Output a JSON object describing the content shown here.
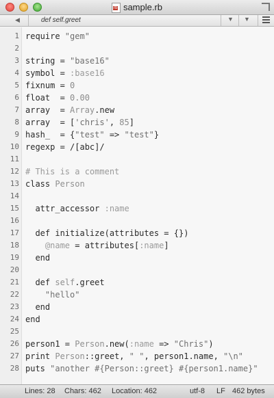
{
  "window": {
    "title": "sample.rb",
    "file_icon_text": "rb",
    "icons": [
      "close-button",
      "minimize-button",
      "zoom-button",
      "ruby-file-icon",
      "fullscreen-icon"
    ]
  },
  "symbol_bar": {
    "current_symbol": "def self.greet",
    "left_arrow": "◀",
    "down_arrow_1": "▼",
    "down_arrow_2": "▼"
  },
  "editor": {
    "lines": [
      {
        "n": "1",
        "segs": [
          [
            "p",
            "require "
          ],
          [
            "s",
            "\"gem\""
          ]
        ]
      },
      {
        "n": "2",
        "segs": []
      },
      {
        "n": "3",
        "segs": [
          [
            "p",
            "string = "
          ],
          [
            "s",
            "\"base16\""
          ]
        ]
      },
      {
        "n": "4",
        "segs": [
          [
            "p",
            "symbol = "
          ],
          [
            "y",
            ":base16"
          ]
        ]
      },
      {
        "n": "5",
        "segs": [
          [
            "p",
            "fixnum = "
          ],
          [
            "n",
            "0"
          ]
        ]
      },
      {
        "n": "6",
        "segs": [
          [
            "p",
            "float  = "
          ],
          [
            "n",
            "0.00"
          ]
        ]
      },
      {
        "n": "7",
        "segs": [
          [
            "p",
            "array  = "
          ],
          [
            "c",
            "Array"
          ],
          [
            "p",
            ".new"
          ]
        ]
      },
      {
        "n": "8",
        "segs": [
          [
            "p",
            "array  = ["
          ],
          [
            "s",
            "'chris'"
          ],
          [
            "p",
            ", "
          ],
          [
            "n",
            "85"
          ],
          [
            "p",
            "]"
          ]
        ]
      },
      {
        "n": "9",
        "segs": [
          [
            "p",
            "hash_  = {"
          ],
          [
            "s",
            "\"test\""
          ],
          [
            "p",
            " => "
          ],
          [
            "s",
            "\"test\""
          ],
          [
            "p",
            "}"
          ]
        ]
      },
      {
        "n": "10",
        "segs": [
          [
            "p",
            "regexp = /[abc]/"
          ]
        ]
      },
      {
        "n": "11",
        "segs": []
      },
      {
        "n": "12",
        "segs": [
          [
            "m",
            "# This is a comment"
          ]
        ]
      },
      {
        "n": "13",
        "segs": [
          [
            "p",
            "class "
          ],
          [
            "c",
            "Person"
          ]
        ]
      },
      {
        "n": "14",
        "segs": []
      },
      {
        "n": "15",
        "segs": [
          [
            "p",
            "  attr_accessor "
          ],
          [
            "y",
            ":name"
          ]
        ]
      },
      {
        "n": "16",
        "segs": []
      },
      {
        "n": "17",
        "segs": [
          [
            "p",
            "  def initialize(attributes = {})"
          ]
        ]
      },
      {
        "n": "18",
        "segs": [
          [
            "p",
            "    "
          ],
          [
            "y",
            "@name"
          ],
          [
            "p",
            " = attributes["
          ],
          [
            "y",
            ":name"
          ],
          [
            "p",
            "]"
          ]
        ]
      },
      {
        "n": "19",
        "segs": [
          [
            "p",
            "  end"
          ]
        ]
      },
      {
        "n": "20",
        "segs": []
      },
      {
        "n": "21",
        "segs": [
          [
            "p",
            "  def "
          ],
          [
            "c",
            "self"
          ],
          [
            "p",
            ".greet"
          ]
        ]
      },
      {
        "n": "22",
        "segs": [
          [
            "p",
            "    "
          ],
          [
            "s",
            "\"hello\""
          ]
        ]
      },
      {
        "n": "23",
        "segs": [
          [
            "p",
            "  end"
          ]
        ]
      },
      {
        "n": "24",
        "segs": [
          [
            "p",
            "end"
          ]
        ]
      },
      {
        "n": "25",
        "segs": []
      },
      {
        "n": "26",
        "segs": [
          [
            "p",
            "person1 = "
          ],
          [
            "c",
            "Person"
          ],
          [
            "p",
            ".new("
          ],
          [
            "y",
            ":name"
          ],
          [
            "p",
            " => "
          ],
          [
            "s",
            "\"Chris\""
          ],
          [
            "p",
            ")"
          ]
        ]
      },
      {
        "n": "27",
        "segs": [
          [
            "p",
            "print "
          ],
          [
            "c",
            "Person"
          ],
          [
            "p",
            "::greet, "
          ],
          [
            "s",
            "\" \""
          ],
          [
            "p",
            ", person1.name, "
          ],
          [
            "s",
            "\"\\n\""
          ]
        ]
      },
      {
        "n": "28",
        "segs": [
          [
            "p",
            "puts "
          ],
          [
            "s",
            "\"another #{Person::greet} #{person1.name}\""
          ]
        ]
      }
    ]
  },
  "status_bar": {
    "lines": "Lines: 28",
    "chars": "Chars: 462",
    "location": "Location: 462",
    "encoding": "utf-8",
    "line_ending": "LF",
    "size": "462 bytes"
  },
  "colors": {
    "background": "#f7f7f7",
    "gutter": "#efefef",
    "string": "#6f6f6f",
    "symbol": "#9a9a9a",
    "comment": "#9a9a9a"
  }
}
